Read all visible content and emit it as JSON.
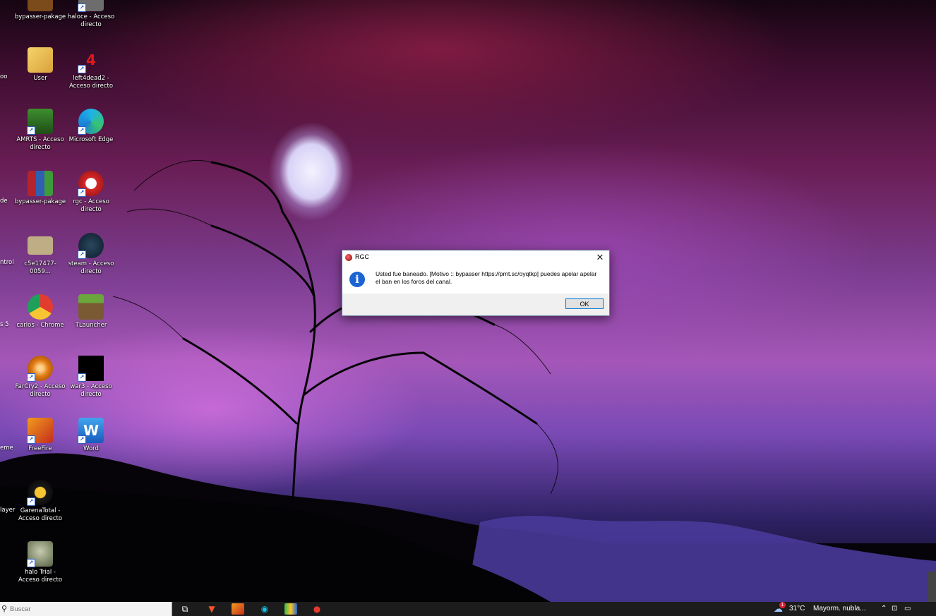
{
  "desktop": {
    "icons": [
      {
        "label": "bypasser-pakage"
      },
      {
        "label": "haloce - Acceso directo"
      },
      {
        "label": "User"
      },
      {
        "label": "left4dead2 - Acceso directo"
      },
      {
        "label": "AMRTS - Acceso directo"
      },
      {
        "label": "Microsoft Edge"
      },
      {
        "label": "bypasser-pakage"
      },
      {
        "label": "rgc - Acceso directo"
      },
      {
        "label": "c5e17477-0059..."
      },
      {
        "label": "steam - Acceso directo"
      },
      {
        "label": "carlos - Chrome"
      },
      {
        "label": "TLauncher"
      },
      {
        "label": "FarCry2 - Acceso directo"
      },
      {
        "label": "war3 - Acceso directo"
      },
      {
        "label": "FreeFire"
      },
      {
        "label": "Word"
      },
      {
        "label": "GarenaTotal - Acceso directo"
      },
      {
        "label": "halo Trial - Acceso directo"
      }
    ],
    "partial_labels": [
      "oo",
      "de",
      "ntrol",
      "s 5",
      "eme",
      "layer"
    ]
  },
  "dialog": {
    "title": "RGC",
    "close_glyph": "✕",
    "info_glyph": "i",
    "message": "Usted fue baneado. [Motivo :: bypasser https://prnt.sc/oyqtkp] puedes apelar apelar el ban en los foros del canal.",
    "ok_label": "OK"
  },
  "taskbar": {
    "search_placeholder": "Buscar",
    "apps": [
      "task-view",
      "brave",
      "freefire",
      "garena",
      "bluestacks",
      "rgc"
    ],
    "weather": {
      "temp": "31°C",
      "condition": "Mayorm. nubla...",
      "alert": "1"
    }
  },
  "colors": {
    "accent": "#0078d7",
    "info_blue": "#1b64d1",
    "taskbar": "#1c1c1c"
  }
}
